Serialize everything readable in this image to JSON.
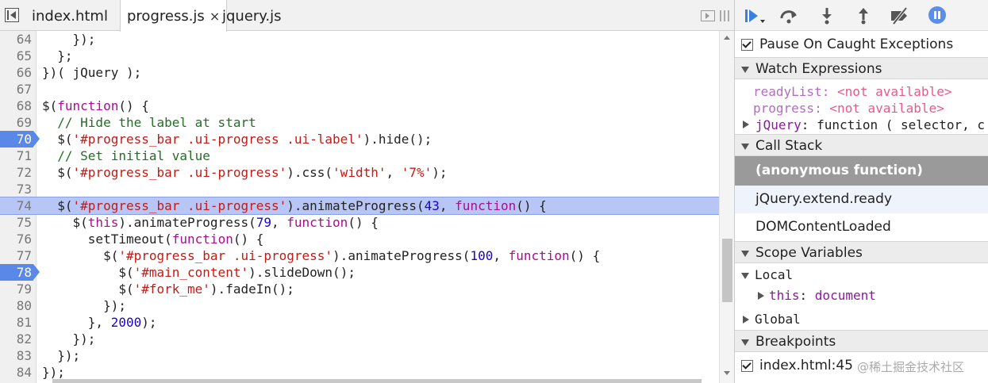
{
  "tabs": [
    {
      "label": "index.html"
    },
    {
      "label": "progress.js",
      "close": "×"
    },
    {
      "label": "jquery.js"
    }
  ],
  "code_lines": [
    {
      "n": "64",
      "html": "    });"
    },
    {
      "n": "65",
      "html": "  };"
    },
    {
      "n": "66",
      "html": "})( jQuery );"
    },
    {
      "n": "67",
      "html": ""
    },
    {
      "n": "68",
      "html": "$(<span class=\"kw\">function</span>() {"
    },
    {
      "n": "69",
      "html": "  <span class=\"cm\">// Hide the label at start</span>"
    },
    {
      "n": "70",
      "html": "  $(<span class=\"str\">'#progress_bar .ui-progress .ui-label'</span>).hide();",
      "breakpoint": true
    },
    {
      "n": "71",
      "html": "  <span class=\"cm\">// Set initial value</span>"
    },
    {
      "n": "72",
      "html": "  $(<span class=\"str\">'#progress_bar .ui-progress'</span>).css(<span class=\"str\">'width'</span>, <span class=\"str\">'7%'</span>);"
    },
    {
      "n": "73",
      "html": ""
    },
    {
      "n": "74",
      "html": "  $(<span class=\"str\">'#progress_bar .ui-progress'</span>).animateProgress(<span class=\"num\">43</span>, <span class=\"kw\">function</span>() {",
      "current": true
    },
    {
      "n": "75",
      "html": "    $(<span class=\"kw\">this</span>).animateProgress(<span class=\"num\">79</span>, <span class=\"kw\">function</span>() {"
    },
    {
      "n": "76",
      "html": "      setTimeout(<span class=\"kw\">function</span>() {"
    },
    {
      "n": "77",
      "html": "        $(<span class=\"str\">'#progress_bar .ui-progress'</span>).animateProgress(<span class=\"num\">100</span>, <span class=\"kw\">function</span>() {"
    },
    {
      "n": "78",
      "html": "          $(<span class=\"str\">'#main_content'</span>).slideDown();",
      "breakpoint": true
    },
    {
      "n": "79",
      "html": "          $(<span class=\"str\">'#fork_me'</span>).fadeIn();"
    },
    {
      "n": "80",
      "html": "        });"
    },
    {
      "n": "81",
      "html": "      }, <span class=\"num\">2000</span>);"
    },
    {
      "n": "82",
      "html": "    });"
    },
    {
      "n": "83",
      "html": "  });"
    },
    {
      "n": "84",
      "html": "});"
    }
  ],
  "panel": {
    "pause_on_caught": "Pause On Caught Exceptions",
    "watch": {
      "title": "Watch Expressions",
      "items": [
        {
          "name": "readyList",
          "sep": ": ",
          "value": "<not available>"
        },
        {
          "name": "progress",
          "sep": ": ",
          "value": "<not available>"
        },
        {
          "name": "jQuery",
          "sep": ": ",
          "value": "function ( selector, c"
        }
      ]
    },
    "call_stack": {
      "title": "Call Stack",
      "frames": [
        "(anonymous function)",
        "jQuery.extend.ready",
        "DOMContentLoaded"
      ]
    },
    "scope": {
      "title": "Scope Variables",
      "local": "Local",
      "this_name": "this",
      "this_sep": ": ",
      "this_value": "document",
      "global": "Global"
    },
    "breakpoints": {
      "title": "Breakpoints",
      "items": [
        "index.html:45"
      ]
    }
  },
  "watermark": "@稀土掘金技术社区",
  "icons": [
    "resume-icon",
    "step-over-icon",
    "step-into-icon",
    "step-out-icon",
    "deactivate-breakpoints-icon",
    "pause-on-exceptions-icon"
  ],
  "colors": {
    "current_line": "#b8c6f5",
    "breakpoint": "#5a88e8",
    "selected_frame": "#9a9a9a"
  }
}
